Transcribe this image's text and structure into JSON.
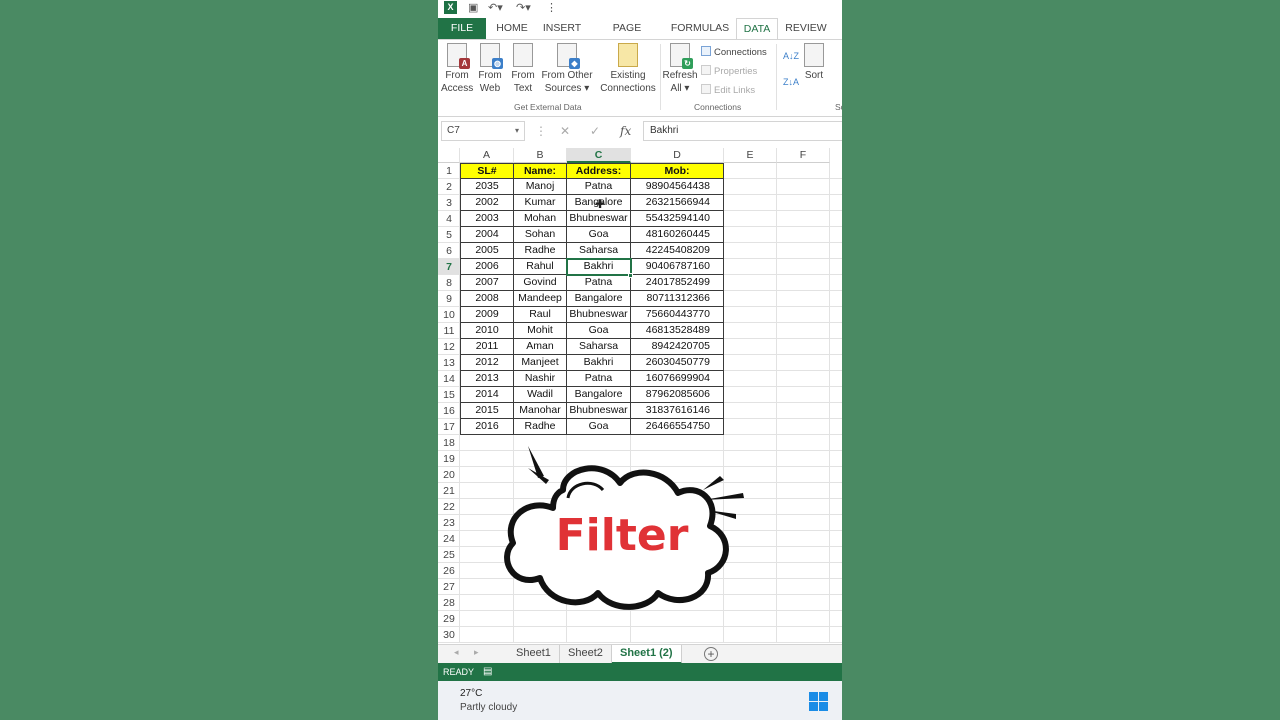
{
  "quick_access": {
    "app_icon": "excel-icon",
    "save_icon": "save-icon",
    "undo_icon": "undo-icon",
    "redo_icon": "redo-icon"
  },
  "ribbon_tabs": [
    "FILE",
    "HOME",
    "INSERT",
    "PAGE LAYOUT",
    "FORMULAS",
    "DATA",
    "REVIEW"
  ],
  "ribbon": {
    "from_access": "From\nAccess",
    "from_web": "From\nWeb",
    "from_text": "From\nText",
    "from_other": "From Other\nSources ▾",
    "existing_connections": "Existing\nConnections",
    "refresh_all": "Refresh\nAll ▾",
    "connections": "Connections",
    "properties": "Properties",
    "edit_links": "Edit Links",
    "sort": "Sort",
    "group_external": "Get External Data",
    "group_connections": "Connections",
    "group_sort_partial": "So"
  },
  "formula_bar": {
    "name_box": "C7",
    "fx": "fx",
    "value": "Bakhri"
  },
  "columns": [
    "A",
    "B",
    "C",
    "D",
    "E",
    "F"
  ],
  "row_numbers": [
    "1",
    "2",
    "3",
    "4",
    "5",
    "6",
    "7",
    "8",
    "9",
    "10",
    "11",
    "12",
    "13",
    "14",
    "15",
    "16",
    "17",
    "18",
    "19",
    "20",
    "21",
    "22",
    "23",
    "24",
    "25",
    "26",
    "27",
    "28",
    "29",
    "30"
  ],
  "table": {
    "headers": [
      "SL#",
      "Name:",
      "Address:",
      "Mob:"
    ],
    "rows": [
      [
        "2035",
        "Manoj",
        "Patna",
        "98904564438"
      ],
      [
        "2002",
        "Kumar",
        "Bangalore",
        "26321566944"
      ],
      [
        "2003",
        "Mohan",
        "Bhubneswar",
        "55432594140"
      ],
      [
        "2004",
        "Sohan",
        "Goa",
        "48160260445"
      ],
      [
        "2005",
        "Radhe",
        "Saharsa",
        "42245408209"
      ],
      [
        "2006",
        "Rahul",
        "Bakhri",
        "90406787160"
      ],
      [
        "2007",
        "Govind",
        "Patna",
        "24017852499"
      ],
      [
        "2008",
        "Mandeep",
        "Bangalore",
        "80711312366"
      ],
      [
        "2009",
        "Raul",
        "Bhubneswar",
        "75660443770"
      ],
      [
        "2010",
        "Mohit",
        "Goa",
        "46813528489"
      ],
      [
        "2011",
        "Aman",
        "Saharsa",
        "8942420705"
      ],
      [
        "2012",
        "Manjeet",
        "Bakhri",
        "26030450779"
      ],
      [
        "2013",
        "Nashir",
        "Patna",
        "16076699904"
      ],
      [
        "2014",
        "Wadil",
        "Bangalore",
        "87962085606"
      ],
      [
        "2015",
        "Manohar",
        "Bhubneswar",
        "31837616146"
      ],
      [
        "2016",
        "Radhe",
        "Goa",
        "26466554750"
      ]
    ]
  },
  "sheet_tabs": [
    "Sheet1",
    "Sheet2",
    "Sheet1 (2)"
  ],
  "status": {
    "ready": "READY"
  },
  "taskbar": {
    "temperature": "27°C",
    "condition": "Partly cloudy"
  },
  "sticker": {
    "text": "Filter"
  },
  "colors": {
    "excel_green": "#217346",
    "header_fill": "#ffff00",
    "sticker_text": "#e03236"
  }
}
